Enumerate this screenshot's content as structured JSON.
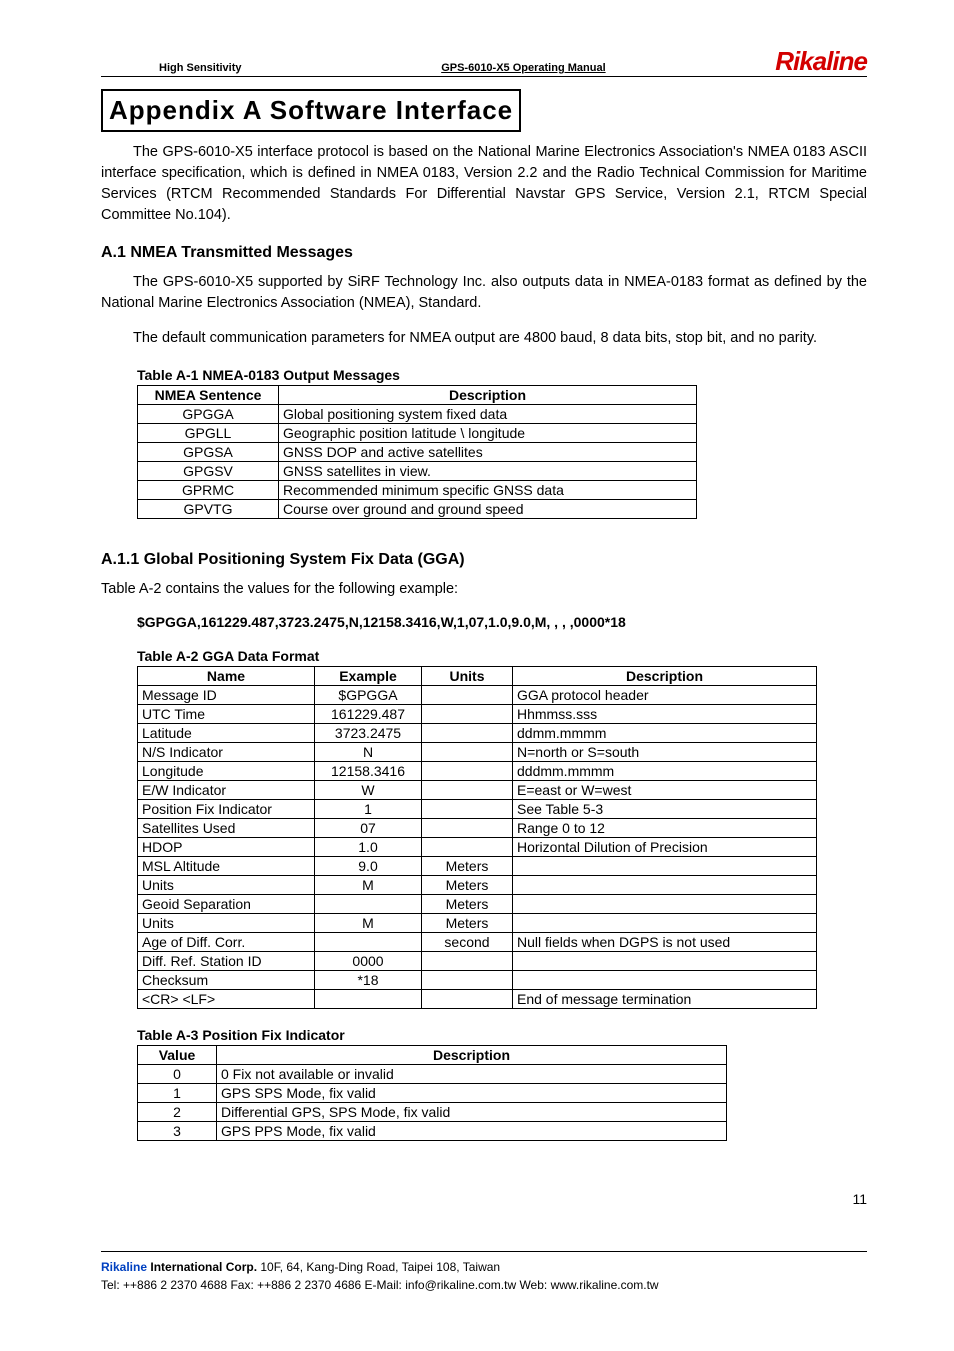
{
  "header": {
    "left": "High Sensitivity",
    "center": "GPS-6010-X5  Operating  Manual",
    "brand": "Rikaline"
  },
  "title": "Appendix   A      Software Interface",
  "intro": "The GPS-6010-X5 interface protocol is based on the National Marine Electronics Association's NMEA 0183 ASCII interface specification, which is defined in NMEA 0183, Version 2.2 and the Radio Technical Commission for Maritime Services (RTCM Recommended Standards For Differential Navstar GPS Service, Version 2.1, RTCM Special Committee No.104).",
  "a1": {
    "heading": "A.1 NMEA Transmitted Messages",
    "p1": "The GPS-6010-X5 supported by SiRF Technology Inc. also outputs data in NMEA-0183 format as defined by the National Marine Electronics Association (NMEA), Standard.",
    "p2": "The default communication parameters for NMEA output are 4800 baud, 8 data bits, stop bit, and no parity."
  },
  "tableA1": {
    "caption": "Table A-1 NMEA-0183 Output Messages",
    "headers": [
      "NMEA Sentence",
      "Description"
    ],
    "rows": [
      [
        "GPGGA",
        "Global positioning system fixed data"
      ],
      [
        "GPGLL",
        "Geographic position latitude \\ longitude"
      ],
      [
        "GPGSA",
        "GNSS DOP and active satellites"
      ],
      [
        "GPGSV",
        "GNSS satellites in view."
      ],
      [
        "GPRMC",
        "Recommended minimum specific GNSS data"
      ],
      [
        "GPVTG",
        "Course over ground and ground speed"
      ]
    ]
  },
  "a11": {
    "heading": "A.1.1 Global Positioning System Fix Data (GGA)",
    "p1": "Table A-2 contains the values for the following example:",
    "example": "$GPGGA,161229.487,3723.2475,N,12158.3416,W,1,07,1.0,9.0,M, , , ,0000*18"
  },
  "tableA2": {
    "caption": "Table A-2 GGA Data Format",
    "headers": [
      "Name",
      "Example",
      "Units",
      "Description"
    ],
    "rows": [
      [
        "Message ID",
        "$GPGGA",
        "",
        "GGA protocol header"
      ],
      [
        "UTC Time",
        "161229.487",
        "",
        "Hhmmss.sss"
      ],
      [
        "Latitude",
        "3723.2475",
        "",
        "ddmm.mmmm"
      ],
      [
        "N/S Indicator",
        "N",
        "",
        "N=north or S=south"
      ],
      [
        "Longitude",
        "12158.3416",
        "",
        "dddmm.mmmm"
      ],
      [
        "E/W Indicator",
        "W",
        "",
        "E=east or W=west"
      ],
      [
        "Position Fix Indicator",
        "1",
        "",
        "See Table 5-3"
      ],
      [
        "Satellites Used",
        "07",
        "",
        "Range 0 to 12"
      ],
      [
        "HDOP",
        "1.0",
        "",
        "Horizontal Dilution of Precision"
      ],
      [
        "MSL Altitude",
        "9.0",
        "Meters",
        ""
      ],
      [
        "Units",
        "M",
        "Meters",
        ""
      ],
      [
        "Geoid Separation",
        "",
        "Meters",
        ""
      ],
      [
        "Units",
        "M",
        "Meters",
        ""
      ],
      [
        "Age of Diff. Corr.",
        "",
        "second",
        "Null fields when DGPS is not used"
      ],
      [
        "Diff. Ref. Station ID",
        "0000",
        "",
        ""
      ],
      [
        "Checksum",
        "*18",
        "",
        ""
      ],
      [
        "<CR> <LF>",
        "",
        "",
        "End of message termination"
      ]
    ]
  },
  "tableA3": {
    "caption": "Table A-3 Position Fix Indicator",
    "headers": [
      "Value",
      "Description"
    ],
    "rows": [
      [
        "0",
        "0 Fix not available or invalid"
      ],
      [
        "1",
        "GPS SPS Mode, fix valid"
      ],
      [
        "2",
        "Differential GPS, SPS Mode, fix valid"
      ],
      [
        "3",
        "GPS PPS Mode, fix valid"
      ]
    ]
  },
  "footer": {
    "line1_brand_blue": "Rikaline ",
    "line1_brand_black": "International Corp.",
    "line1_rest": "      10F, 64, Kang-Ding Road, Taipei 108, Taiwan",
    "line2": "Tel: ++886 2 2370 4688     Fax: ++886 2 2370 4686          E-Mail: info@rikaline.com.tw          Web: www.rikaline.com.tw",
    "page_number": "11"
  }
}
